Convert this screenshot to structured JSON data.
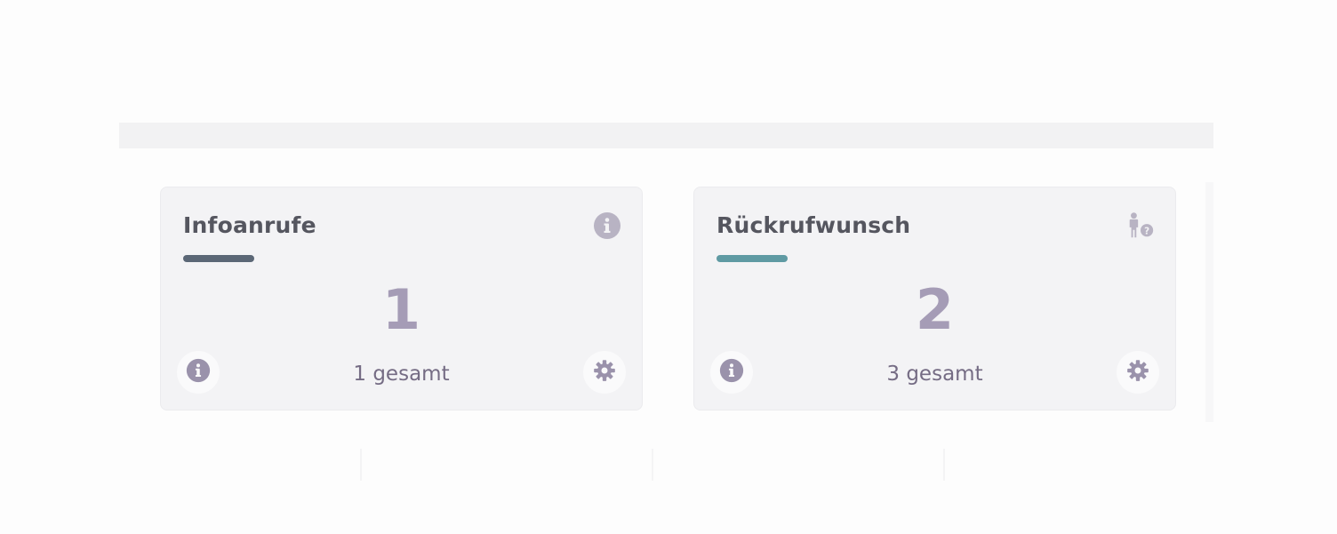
{
  "cards": [
    {
      "title": "Infoanrufe",
      "value": "1",
      "total": "1 gesamt",
      "accent_color": "#5b6776",
      "corner_icon": "info-circle-icon"
    },
    {
      "title": "Rückrufwunsch",
      "value": "2",
      "total": "3 gesamt",
      "accent_color": "#5f9aa3",
      "corner_icon": "person-question-icon"
    }
  ],
  "footer_buttons": {
    "left_icon": "info-circle-icon",
    "right_icon": "gear-icon"
  },
  "colors": {
    "icon": "#9a92ab",
    "icon_muted": "#b8b3c3",
    "value": "#a59cb6",
    "title": "#55565f"
  }
}
